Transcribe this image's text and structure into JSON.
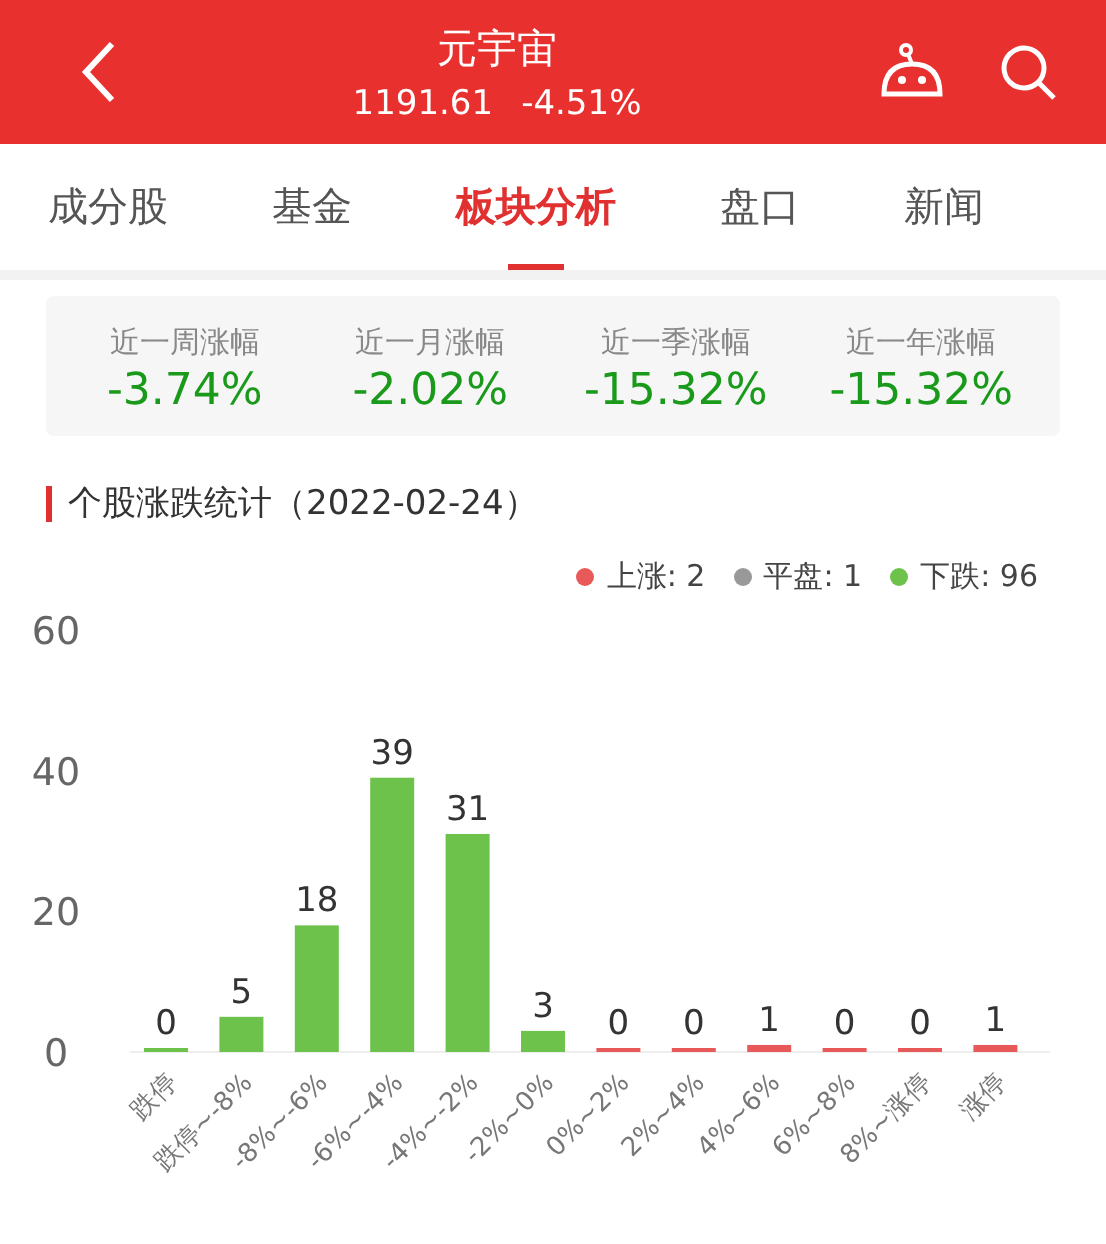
{
  "header": {
    "title": "元宇宙",
    "price": "1191.61",
    "change": "-4.51%"
  },
  "tabs": [
    {
      "label": "成分股",
      "selected": false
    },
    {
      "label": "基金",
      "selected": false
    },
    {
      "label": "板块分析",
      "selected": true
    },
    {
      "label": "盘口",
      "selected": false
    },
    {
      "label": "新闻",
      "selected": false
    }
  ],
  "stats": [
    {
      "label": "近一周涨幅",
      "value": "-3.74%"
    },
    {
      "label": "近一月涨幅",
      "value": "-2.02%"
    },
    {
      "label": "近一季涨幅",
      "value": "-15.32%"
    },
    {
      "label": "近一年涨幅",
      "value": "-15.32%"
    }
  ],
  "section_title": "个股涨跌统计（2022-02-24）",
  "legend": [
    {
      "label": "上涨: 2",
      "color": "#e85a5a"
    },
    {
      "label": "平盘: 1",
      "color": "#999999"
    },
    {
      "label": "下跌: 96",
      "color": "#6cc24a"
    }
  ],
  "chart_data": {
    "type": "bar",
    "data_labels": true,
    "categories": [
      "跌停",
      "跌停~-8%",
      "-8%~-6%",
      "-6%~-4%",
      "-4%~-2%",
      "-2%~0%",
      "0%~2%",
      "2%~4%",
      "4%~6%",
      "6%~8%",
      "8%~涨停",
      "涨停"
    ],
    "yticks": [
      0,
      20,
      40,
      60
    ],
    "ylim": [
      0,
      60
    ],
    "series": [
      {
        "color": "#6cc24a",
        "values": [
          0,
          5,
          18,
          39,
          31,
          3,
          null,
          null,
          null,
          null,
          null,
          null
        ]
      },
      {
        "color": "#e85a5a",
        "values": [
          null,
          null,
          null,
          null,
          null,
          null,
          0,
          0,
          1,
          0,
          0,
          1
        ]
      }
    ]
  }
}
